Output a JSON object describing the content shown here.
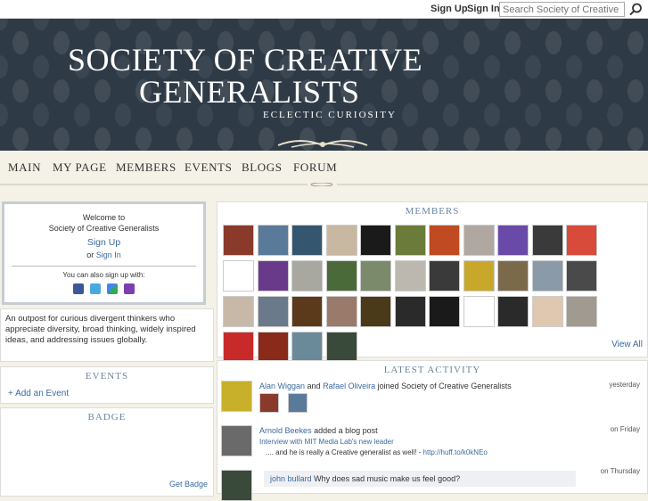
{
  "topbar": {
    "signup": "Sign Up",
    "signin": "Sign In",
    "search_placeholder": "Search Society of Creative Generalists"
  },
  "header": {
    "title_line1": "SOCIETY OF CREATIVE",
    "title_line2": "GENERALISTS",
    "tagline": "ECLECTIC CURIOSITY"
  },
  "nav": {
    "items": [
      "MAIN",
      "MY PAGE",
      "MEMBERS",
      "EVENTS",
      "BLOGS",
      "FORUM"
    ]
  },
  "welcome": {
    "line1": "Welcome to",
    "line2": "Society of Creative Generalists",
    "signup": "Sign Up",
    "or": "or",
    "signin": "Sign In",
    "also": "You can also sign up with:"
  },
  "about": {
    "text": "An outpost for curious divergent thinkers who appreciate diversity, broad thinking, widely inspired ideas, and addressing issues globally."
  },
  "events": {
    "title": "EVENTS",
    "add": "+ Add an Event"
  },
  "badge": {
    "title": "BADGE",
    "get": "Get Badge"
  },
  "members": {
    "title": "MEMBERS",
    "view_all": "View All",
    "avatar_colors": [
      "#8a3a2a",
      "#5a7a9a",
      "#34566e",
      "#c8b8a2",
      "#1a1a1a",
      "#6b7b3a",
      "#c04a22",
      "#b0a8a0",
      "#6a4aa8",
      "#3a3a3a",
      "#d84a3a",
      "#ffffff",
      "#6a3a8a",
      "#a8a8a0",
      "#4a6a3a",
      "#7a8a6a",
      "#bcb8b0",
      "#3a3a3a",
      "#c8a82a",
      "#7a6a4a",
      "#8a9aa8",
      "#4a4a4a",
      "#c8b8a8",
      "#6a7a8a",
      "#5a3a1a",
      "#9a7a6a",
      "#4a3a1a",
      "#2a2a2a",
      "#1a1a1a",
      "#ffffff",
      "#2a2a2a",
      "#e0c8b0",
      "#a09a90",
      "#c82a2a",
      "#8a2a1a",
      "#6a8a9a",
      "#3a4a3a"
    ]
  },
  "activity": {
    "title": "LATEST ACTIVITY",
    "rows": [
      {
        "user1": "Alan Wiggan",
        "and": "and",
        "user2": "Rafael Oliveira",
        "action": "joined Society of Creative Generalists",
        "time": "yesterday"
      },
      {
        "user": "Arnold Beekes",
        "action": "added a blog post",
        "post_title": "Interview with MIT Media Lab's new leader",
        "excerpt": ".... and he is really a Creative generalist as well!",
        "link": "http://huff.to/k0kNEo",
        "time": "on Friday"
      },
      {
        "user": "john bullard",
        "action": "Why does sad music make us feel good?",
        "time": "on Thursday"
      }
    ]
  },
  "colors": {
    "header_bg": "#2e3a46",
    "link": "#3b6aa0",
    "panel_title": "#6a86a3",
    "page_bg": "#f4f1e6"
  }
}
